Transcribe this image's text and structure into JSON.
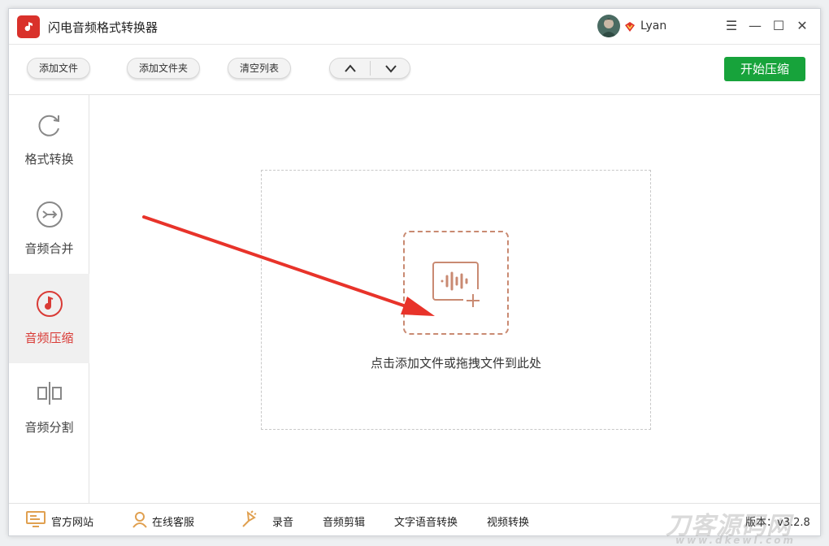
{
  "app": {
    "title": "闪电音频格式转换器",
    "icon": "music-note-icon",
    "user": "Lyan"
  },
  "window_controls": {
    "menu": "☰",
    "minimize": "—",
    "maximize": "☐",
    "close": "✕"
  },
  "toolbar": {
    "add_file": "添加文件",
    "add_folder": "添加文件夹",
    "clear_list": "清空列表",
    "start": "开始压缩"
  },
  "sidebar": {
    "items": [
      {
        "label": "格式转换",
        "icon": "refresh-icon",
        "active": false
      },
      {
        "label": "音频合并",
        "icon": "merge-icon",
        "active": false
      },
      {
        "label": "音频压缩",
        "icon": "music-note-icon",
        "active": true
      },
      {
        "label": "音频分割",
        "icon": "split-icon",
        "active": false
      }
    ]
  },
  "main": {
    "drop_text": "点击添加文件或拖拽文件到此处"
  },
  "footer": {
    "website": "官方网站",
    "support": "在线客服",
    "record": "录音",
    "audio_edit": "音频剪辑",
    "tts": "文字语音转换",
    "video_convert": "视频转换",
    "version": "版本：v3.2.8",
    "watermark": "刀客源码网",
    "watermark_sub": "www.dkewl.com"
  },
  "colors": {
    "accent_red": "#d93b36",
    "start_green": "#17a33b",
    "dropzone_icon": "#c98a72"
  }
}
